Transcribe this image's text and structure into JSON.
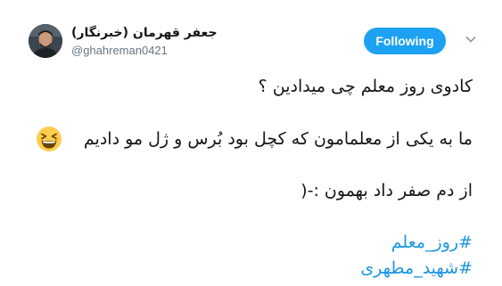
{
  "author": {
    "display_name": "جعفر قهرمان (خبرنگار)",
    "handle": "@ghahreman0421"
  },
  "follow_button": {
    "label": "Following"
  },
  "tweet": {
    "line1": "کادوی روز معلم چی میدادین ؟",
    "line2": "ما به یکی از معلمامون که کچل بود بُرس و ژل مو دادیم",
    "line3": "از دم صفر داد بهمون :-(",
    "emoji": "grinning-squinting-face-icon",
    "hashtags": [
      {
        "hash": "#",
        "tag": "روز_معلم"
      },
      {
        "hash": "#",
        "tag": "شهید_مطهری"
      }
    ]
  },
  "colors": {
    "accent": "#1da1f2",
    "link": "#1b95e0",
    "text": "#14171a",
    "secondary": "#657786",
    "emoji_face": "#ffcc4d"
  }
}
